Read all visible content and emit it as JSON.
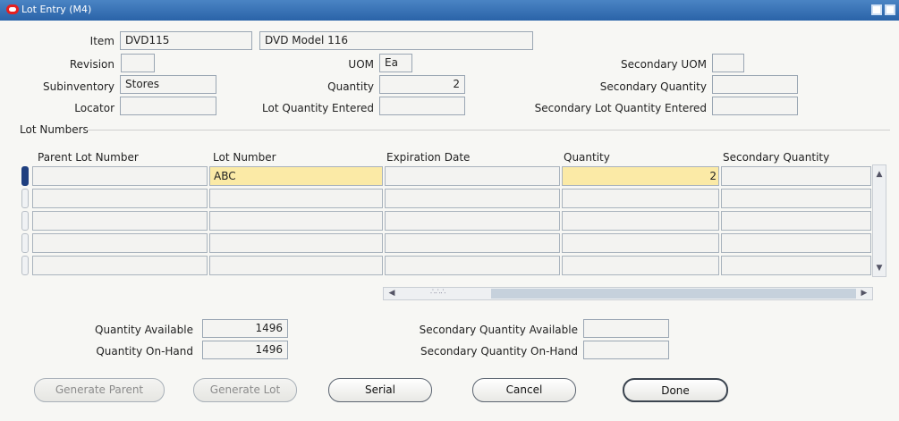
{
  "window": {
    "title": "Lot Entry (M4)"
  },
  "header": {
    "item_label": "Item",
    "item_value": "DVD115",
    "item_desc": "DVD Model 116",
    "revision_label": "Revision",
    "revision_value": "",
    "uom_label": "UOM",
    "uom_value": "Ea",
    "secondary_uom_label": "Secondary UOM",
    "secondary_uom_value": "",
    "subinventory_label": "Subinventory",
    "subinventory_value": "Stores",
    "quantity_label": "Quantity",
    "quantity_value": "2",
    "secondary_quantity_label": "Secondary Quantity",
    "secondary_quantity_value": "",
    "locator_label": "Locator",
    "locator_value": "",
    "lot_qty_entered_label": "Lot Quantity Entered",
    "lot_qty_entered_value": "",
    "sec_lot_qty_entered_label": "Secondary Lot Quantity Entered",
    "sec_lot_qty_entered_value": ""
  },
  "lots": {
    "section_label": "Lot Numbers",
    "columns": [
      "Parent Lot Number",
      "Lot Number",
      "Expiration Date",
      "Quantity",
      "Secondary Quantity"
    ],
    "rows": [
      [
        "",
        "ABC",
        "",
        "2",
        ""
      ],
      [
        "",
        "",
        "",
        "",
        ""
      ],
      [
        "",
        "",
        "",
        "",
        ""
      ],
      [
        "",
        "",
        "",
        "",
        ""
      ],
      [
        "",
        "",
        "",
        "",
        ""
      ]
    ]
  },
  "totals": {
    "qty_available_label": "Quantity Available",
    "qty_available_value": "1496",
    "qty_onhand_label": "Quantity On-Hand",
    "qty_onhand_value": "1496",
    "sec_qty_available_label": "Secondary Quantity Available",
    "sec_qty_available_value": "",
    "sec_qty_onhand_label": "Secondary Quantity On-Hand",
    "sec_qty_onhand_value": ""
  },
  "buttons": {
    "generate_parent": "Generate Parent",
    "generate_lot": "Generate Lot",
    "serial": "Serial",
    "cancel": "Cancel",
    "done": "Done"
  }
}
